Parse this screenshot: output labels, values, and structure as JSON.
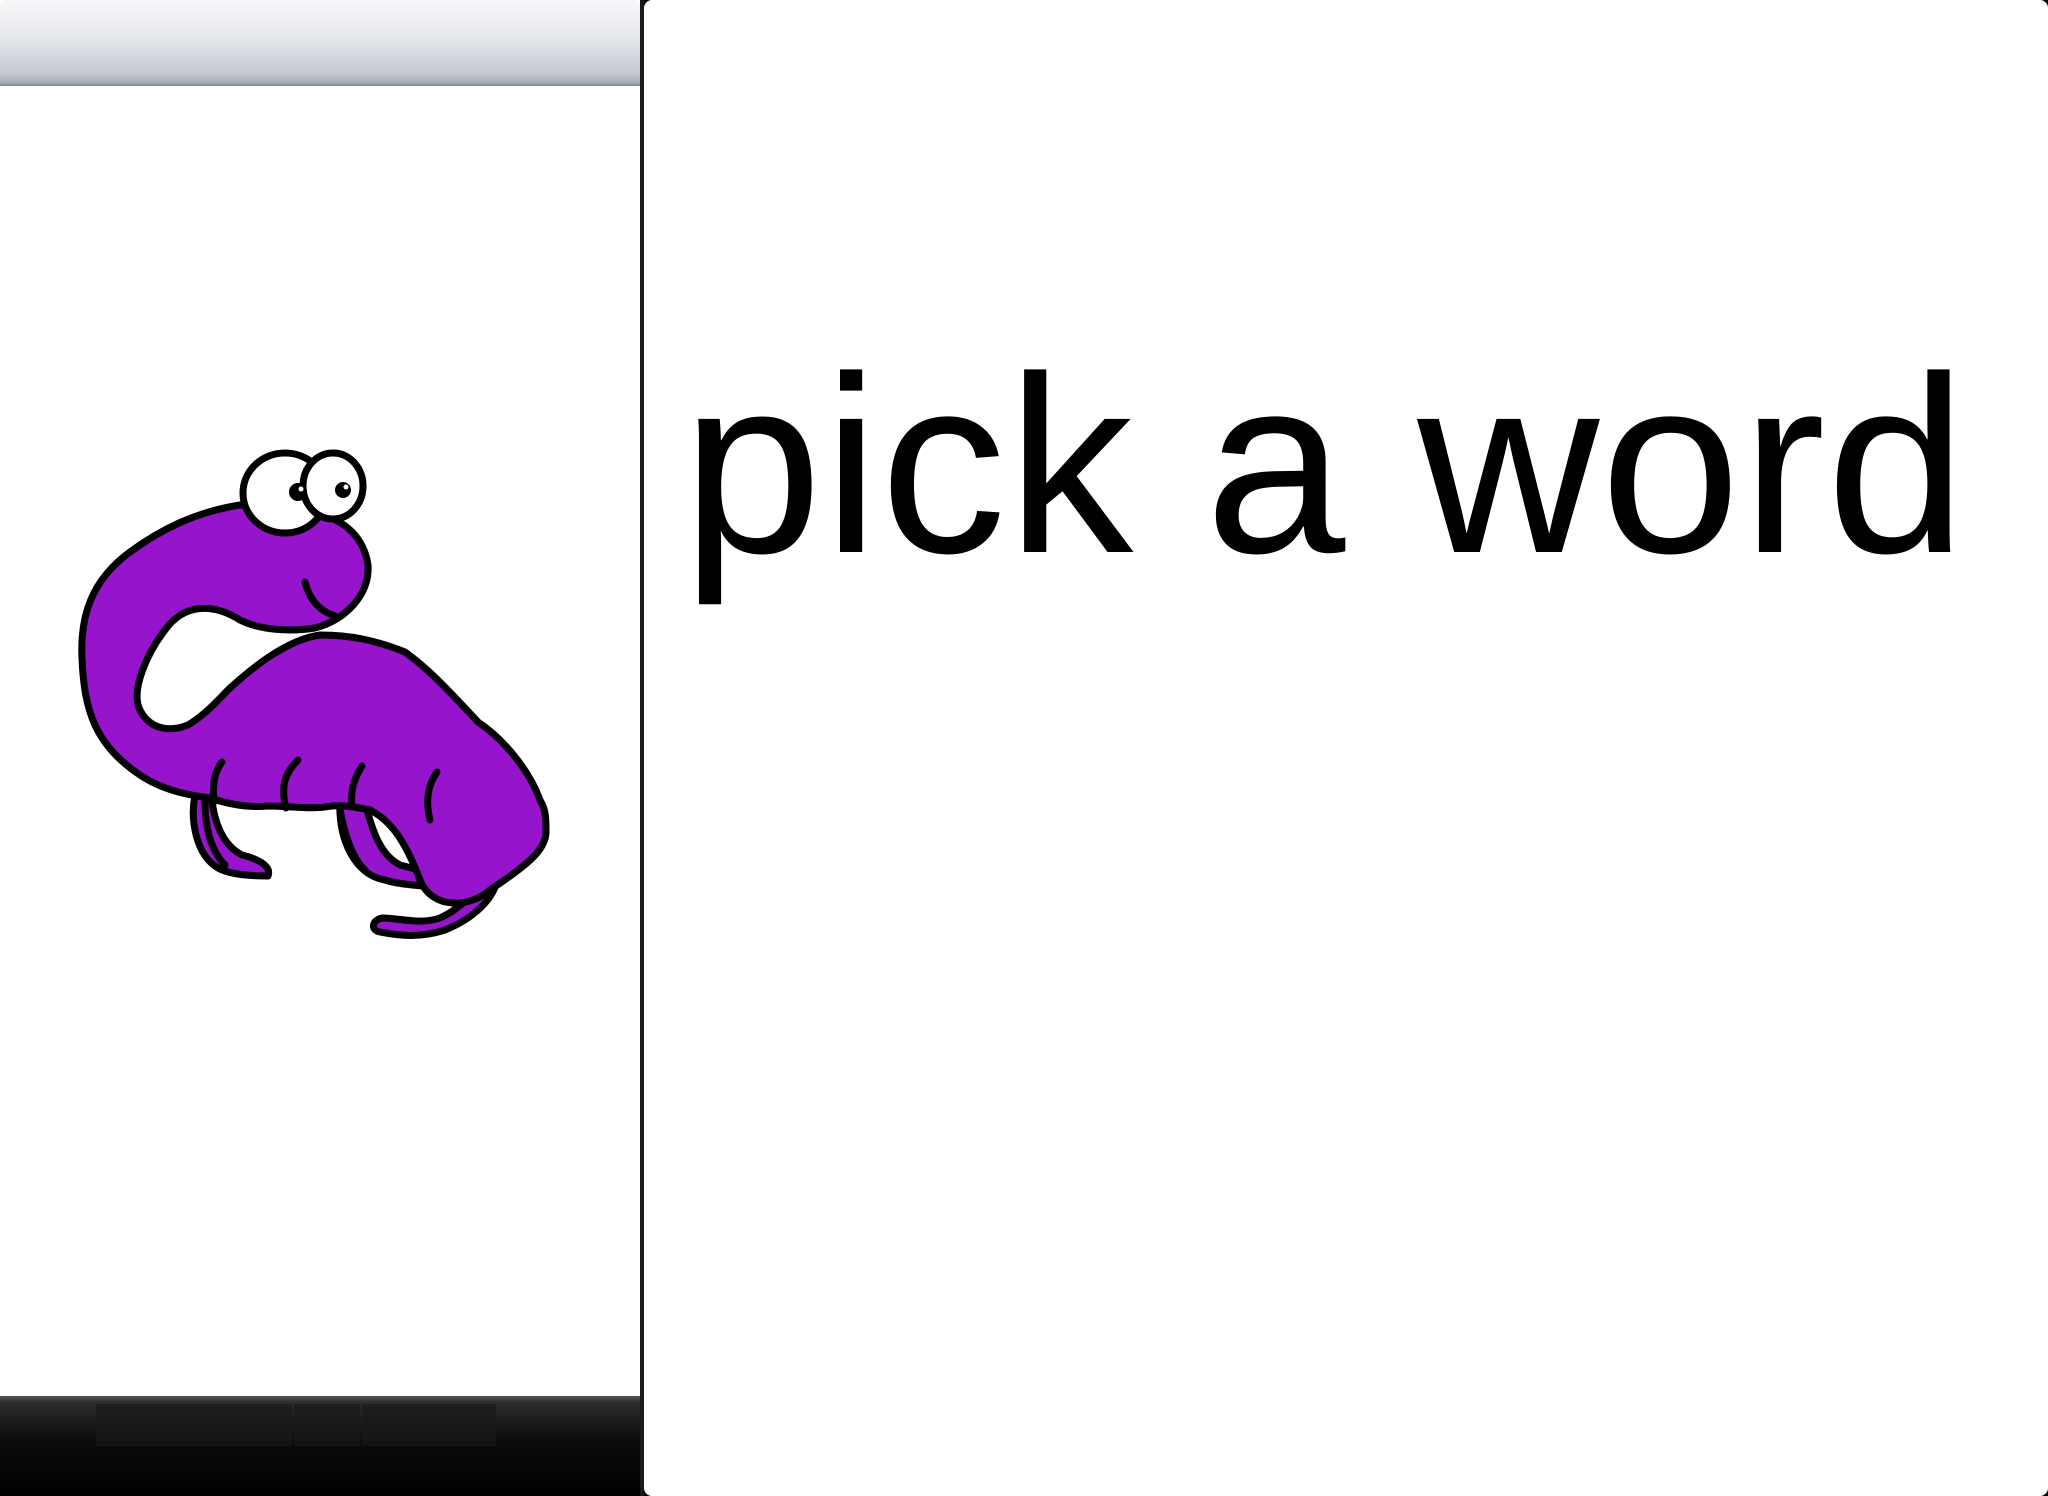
{
  "left_panel": {
    "picture": {
      "name": "purple-dinosaur",
      "body_color": "#9614cc",
      "outline_color": "#000000"
    },
    "header": {
      "title": ""
    },
    "toolbar": {
      "slots": 3
    }
  },
  "right_panel": {
    "prompt": "pick a word"
  },
  "colors": {
    "panel_background": "#ffffff",
    "app_background": "#000000",
    "text": "#000000"
  }
}
